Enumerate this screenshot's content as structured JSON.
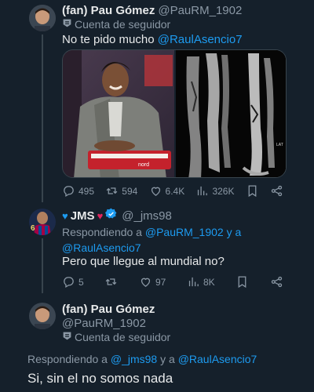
{
  "tweet1": {
    "name": "(fan) Pau Gómez",
    "handle": "@PauRM_1902",
    "badge": "Cuenta de seguidor",
    "text": "No te pido mucho ",
    "mention": "@RaulAsencio7",
    "stats": {
      "replies": "495",
      "retweets": "594",
      "likes": "6.4K",
      "views": "326K"
    },
    "xray_label": "LAT"
  },
  "reply": {
    "name": "JMS",
    "handle": "@_jms98",
    "replying_prefix": "Respondiendo a ",
    "replying_to_1": "@PauRM_1902",
    "replying_and": " y a",
    "replying_to_2": "@RaulAsencio7",
    "text": "Pero que llegue al mundial no?",
    "stats": {
      "replies": "5",
      "likes": "97",
      "views": "8K"
    },
    "avatar_number": "6"
  },
  "focused": {
    "name": "(fan) Pau Gómez",
    "handle": "@PauRM_1902",
    "badge": "Cuenta de seguidor",
    "replying_prefix": "Respondiendo a ",
    "replying_to_1": "@_jms98",
    "replying_and": " y a ",
    "replying_to_2": "@RaulAsencio7",
    "text": "Si, sin el no somos nada"
  },
  "colors": {
    "background": "#15202b",
    "accent": "#1d9bf0",
    "muted": "#8b98a5",
    "heart": "#e0245e"
  }
}
